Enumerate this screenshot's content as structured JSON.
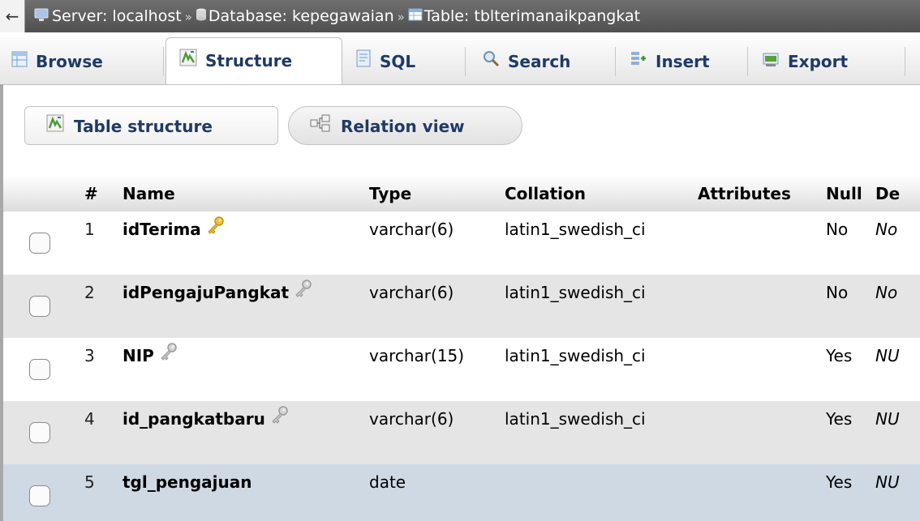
{
  "breadcrumb": {
    "back_arrow": "←",
    "server": "Server: localhost",
    "database": "Database: kepegawaian",
    "table": "Table: tblterimanaikpangkat",
    "separator": "»"
  },
  "tabs": [
    {
      "label": "Browse",
      "icon": "browse-icon",
      "active": false
    },
    {
      "label": "Structure",
      "icon": "structure-icon",
      "active": true
    },
    {
      "label": "SQL",
      "icon": "sql-icon",
      "active": false
    },
    {
      "label": "Search",
      "icon": "search-icon",
      "active": false
    },
    {
      "label": "Insert",
      "icon": "insert-icon",
      "active": false
    },
    {
      "label": "Export",
      "icon": "export-icon",
      "active": false
    }
  ],
  "subtabs": [
    {
      "label": "Table structure",
      "icon": "table-structure-icon"
    },
    {
      "label": "Relation view",
      "icon": "relation-view-icon"
    }
  ],
  "table": {
    "headers": [
      "#",
      "Name",
      "Type",
      "Collation",
      "Attributes",
      "Null",
      "De"
    ],
    "rows": [
      {
        "num": "1",
        "name": "idTerima",
        "key": "primary-key-icon",
        "type": "varchar(6)",
        "collation": "latin1_swedish_ci",
        "attributes": "",
        "null": "No",
        "default": "No"
      },
      {
        "num": "2",
        "name": "idPengajuPangkat",
        "key": "index-key-icon",
        "type": "varchar(6)",
        "collation": "latin1_swedish_ci",
        "attributes": "",
        "null": "No",
        "default": "No"
      },
      {
        "num": "3",
        "name": "NIP",
        "key": "index-key-icon",
        "type": "varchar(15)",
        "collation": "latin1_swedish_ci",
        "attributes": "",
        "null": "Yes",
        "default": "NU"
      },
      {
        "num": "4",
        "name": "id_pangkatbaru",
        "key": "index-key-icon",
        "type": "varchar(6)",
        "collation": "latin1_swedish_ci",
        "attributes": "",
        "null": "Yes",
        "default": "NU"
      },
      {
        "num": "5",
        "name": "tgl_pengajuan",
        "key": "",
        "type": "date",
        "collation": "",
        "attributes": "",
        "null": "Yes",
        "default": "NU"
      }
    ]
  },
  "colors": {
    "accent": "#1f3a66",
    "breadcrumb_bg": "#5a5a5a",
    "row_alt": "#e5e5e5",
    "row_marked": "#cfd9e4",
    "primary_key": "#e6b62e",
    "index_key": "#b8b8b8"
  }
}
